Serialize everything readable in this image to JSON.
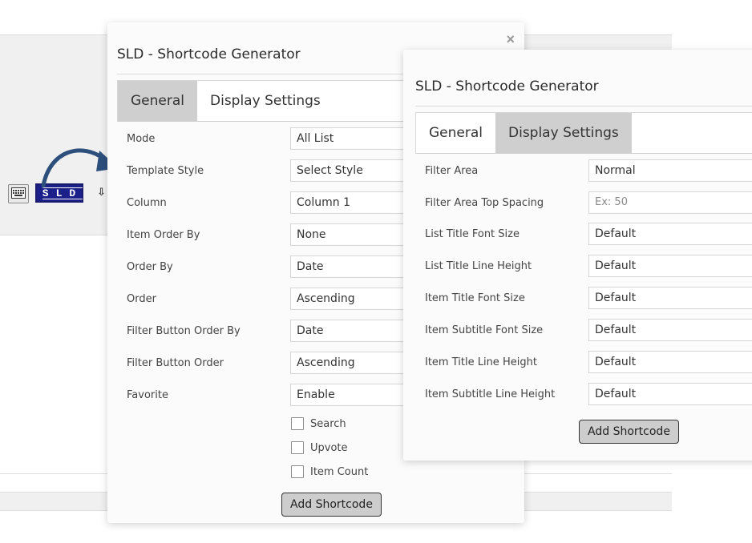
{
  "background": {
    "toolbar": {
      "keyboard_icon": "keyboard-icon",
      "sld_label": "SLD",
      "partial_icon": "insert-icon"
    }
  },
  "dialog_general": {
    "title": "SLD - Shortcode Generator",
    "close_glyph": "×",
    "tabs": [
      {
        "label": "General",
        "active": true
      },
      {
        "label": "Display Settings",
        "active": false
      }
    ],
    "fields": [
      {
        "label": "Mode",
        "value": "All List"
      },
      {
        "label": "Template Style",
        "value": "Select Style"
      },
      {
        "label": "Column",
        "value": "Column 1"
      },
      {
        "label": "Item Order By",
        "value": "None"
      },
      {
        "label": "Order By",
        "value": "Date"
      },
      {
        "label": "Order",
        "value": "Ascending"
      },
      {
        "label": "Filter Button Order By",
        "value": "Date"
      },
      {
        "label": "Filter Button Order",
        "value": "Ascending"
      },
      {
        "label": "Favorite",
        "value": "Enable"
      }
    ],
    "checkboxes": [
      {
        "label": "Search",
        "checked": false
      },
      {
        "label": "Upvote",
        "checked": false
      },
      {
        "label": "Item Count",
        "checked": false
      }
    ],
    "submit_label": "Add Shortcode"
  },
  "dialog_display": {
    "title": "SLD - Shortcode Generator",
    "tabs": [
      {
        "label": "General",
        "active": false
      },
      {
        "label": "Display Settings",
        "active": true
      }
    ],
    "fields": [
      {
        "label": "Filter Area",
        "value": "Normal",
        "placeholder": ""
      },
      {
        "label": "Filter Area Top Spacing",
        "value": "",
        "placeholder": "Ex: 50"
      },
      {
        "label": "List Title Font Size",
        "value": "Default",
        "placeholder": ""
      },
      {
        "label": "List Title Line Height",
        "value": "Default",
        "placeholder": ""
      },
      {
        "label": "Item Title Font Size",
        "value": "Default",
        "placeholder": ""
      },
      {
        "label": "Item Subtitle Font Size",
        "value": "Default",
        "placeholder": ""
      },
      {
        "label": "Item Title Line Height",
        "value": "Default",
        "placeholder": ""
      },
      {
        "label": "Item Subtitle Line Height",
        "value": "Default",
        "placeholder": ""
      }
    ],
    "submit_label": "Add Shortcode"
  },
  "colors": {
    "active_tab": "#cfcfcf",
    "arrow": "#2c4f7c",
    "sld_badge": "#1b1f8a"
  }
}
